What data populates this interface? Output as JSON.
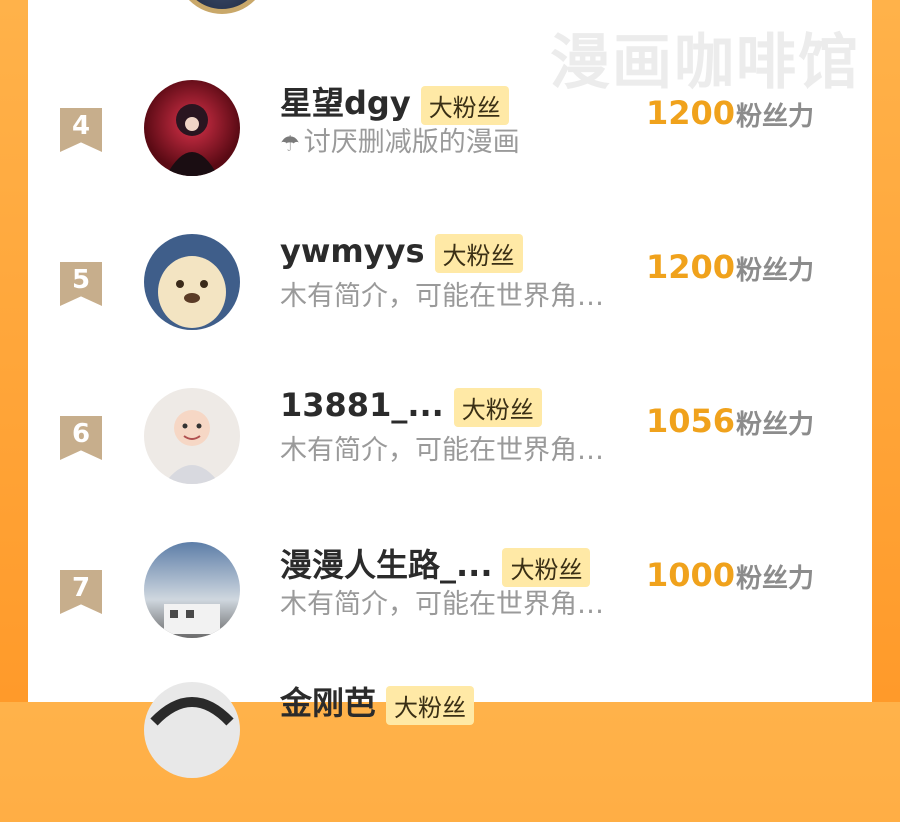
{
  "watermark": "漫画咖啡馆",
  "badge_label": "大粉丝",
  "score_unit": "粉丝力",
  "rows": [
    {
      "rank": "4",
      "name": "星望dgy",
      "desc": "讨厌删减版的漫画",
      "score": "1200",
      "desc_icon": "umbrella-icon"
    },
    {
      "rank": "5",
      "name": "ywmyys",
      "desc": "木有简介，可能在世界角…",
      "score": "1200"
    },
    {
      "rank": "6",
      "name": "13881_...",
      "desc": "木有简介，可能在世界角…",
      "score": "1056"
    },
    {
      "rank": "7",
      "name": "漫漫人生路_...",
      "desc": "木有简介，可能在世界角…",
      "score": "1000"
    },
    {
      "rank": "",
      "name": "金刚芭",
      "desc": "",
      "score": ""
    }
  ],
  "colors": {
    "accent": "#f0a21c",
    "badge_bg": "#ffe9a6",
    "rank_bg": "#c7ae8c",
    "bg": "#ff9a2a"
  }
}
